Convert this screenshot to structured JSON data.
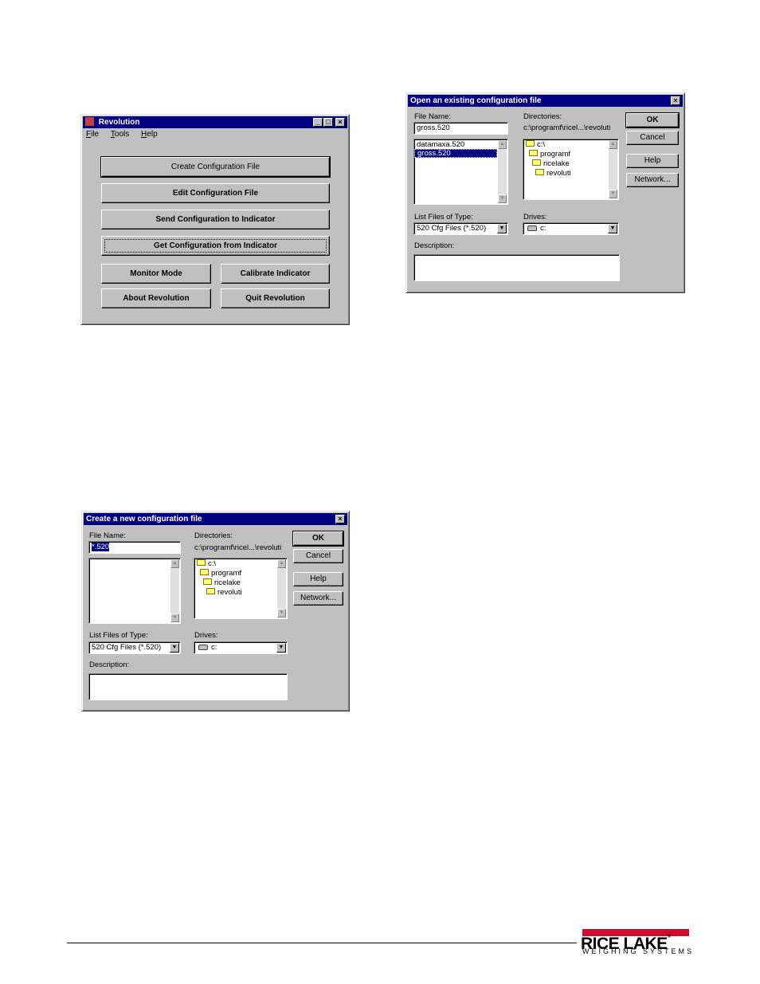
{
  "revolution": {
    "title": "Revolution",
    "menu": [
      {
        "key": "F",
        "rest": "ile"
      },
      {
        "key": "T",
        "rest": "ools"
      },
      {
        "key": "H",
        "rest": "elp"
      }
    ],
    "buttons": {
      "create": "Create Configuration File",
      "edit": "Edit Configuration File",
      "send": "Send Configuration to Indicator",
      "get": "Get Configuration from Indicator",
      "monitor": "Monitor Mode",
      "calibrate": "Calibrate Indicator",
      "about": "About Revolution",
      "quit": "Quit Revolution"
    }
  },
  "open_dialog": {
    "title": "Open an existing configuration file",
    "file_name_label": "File Name:",
    "file_name_value": "gross.520",
    "files": [
      "datamaxa.520",
      "gross.520"
    ],
    "selected_file": "gross.520",
    "directories_label": "Directories:",
    "directory_path": "c:\\programf\\ricel...\\revoluti",
    "dirs": [
      "c:\\",
      "programf",
      "ricelake",
      "revoluti"
    ],
    "list_type_label": "List Files of Type:",
    "list_type_value": "520 Cfg Files (*.520)",
    "drives_label": "Drives:",
    "drives_value": "c:",
    "description_label": "Description:",
    "ok": "OK",
    "cancel": "Cancel",
    "help": "Help",
    "network": "Network..."
  },
  "new_dialog": {
    "title": "Create a new configuration file",
    "file_name_label": "File Name:",
    "file_name_value": "*.520",
    "directories_label": "Directories:",
    "directory_path": "c:\\programf\\ricel...\\revoluti",
    "dirs": [
      "c:\\",
      "programf",
      "ricelake",
      "revoluti"
    ],
    "list_type_label": "List Files of Type:",
    "list_type_value": "520 Cfg Files (*.520)",
    "drives_label": "Drives:",
    "drives_value": "c:",
    "description_label": "Description:",
    "ok": "OK",
    "cancel": "Cancel",
    "help": "Help",
    "network": "Network..."
  },
  "logo": {
    "name": "RICE LAKE",
    "tagline": "WEIGHING SYSTEMS"
  }
}
